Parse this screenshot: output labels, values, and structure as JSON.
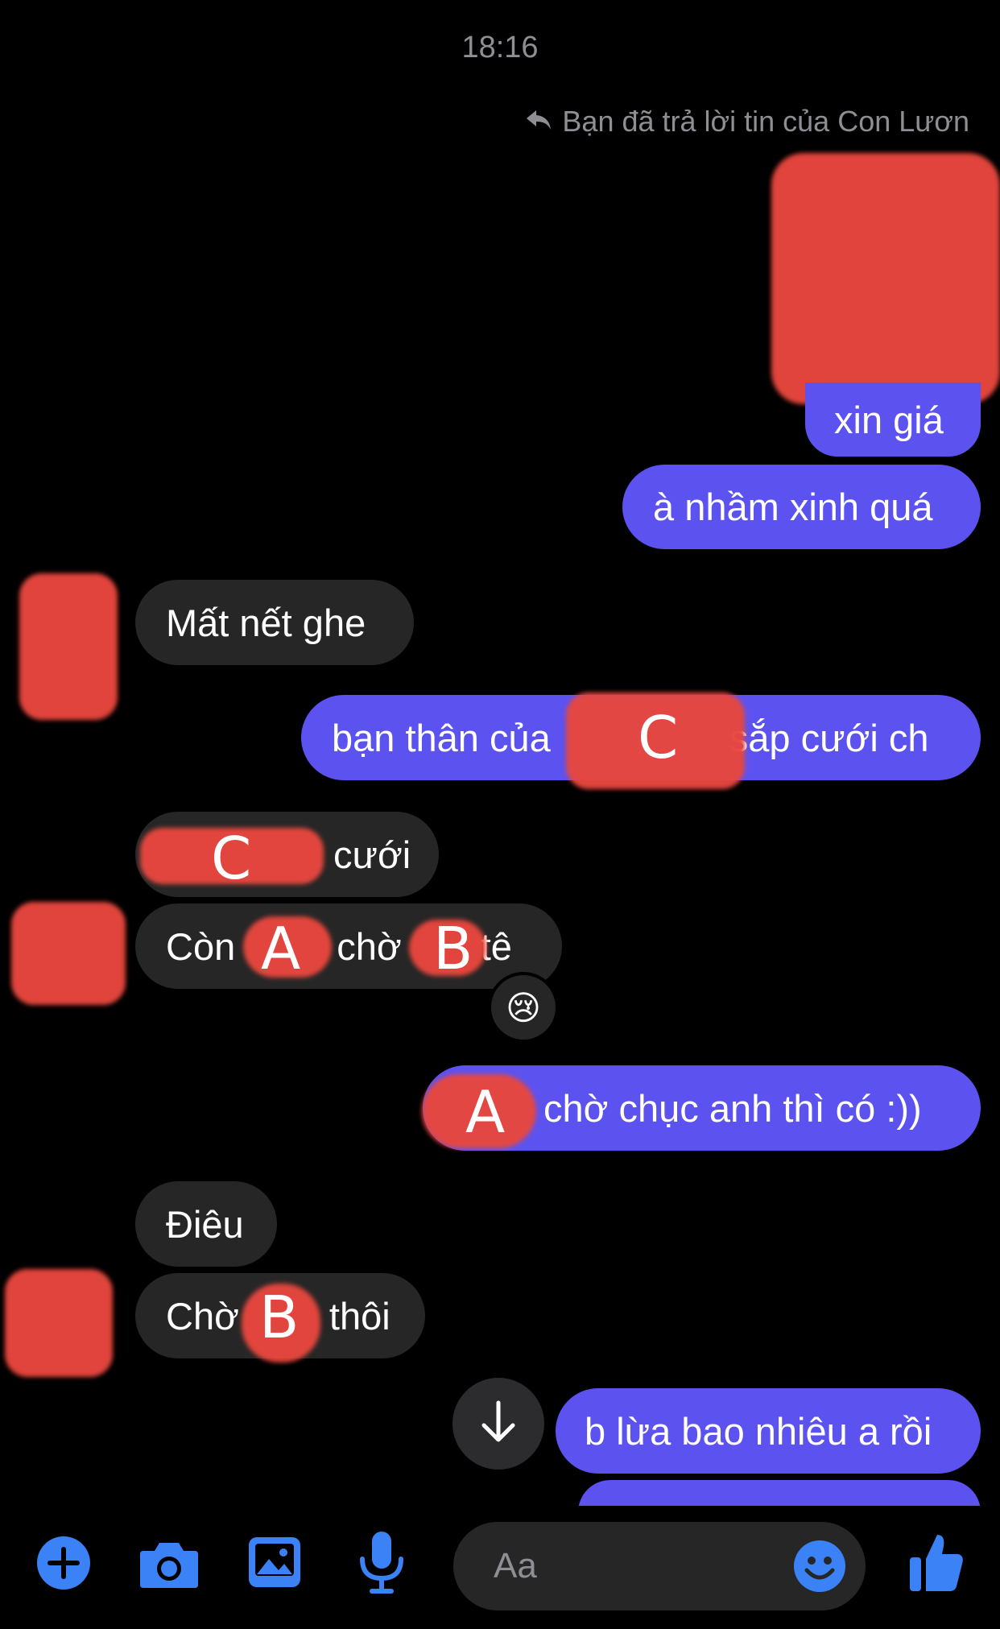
{
  "header": {
    "time": "18:16",
    "reply_note": "Bạn đã trả lời tin của Con Lươn"
  },
  "messages": [
    {
      "text": "xin giá"
    },
    {
      "text": "à nhầm xinh quá"
    },
    {
      "text": "Mất nết ghe"
    },
    {
      "before": "bạn thân của",
      "marker": "C",
      "after": "sắp cưới ch"
    },
    {
      "marker": "C",
      "after": "cưới"
    },
    {
      "before": "Còn",
      "marker1": "A",
      "middle": "chờ",
      "marker2": "B",
      "after": "tê",
      "reaction": "😢"
    },
    {
      "marker": "A",
      "after": "chờ chục anh thì có :))"
    },
    {
      "text": "Điêu"
    },
    {
      "before": "Chờ",
      "marker": "B",
      "after": "thôi"
    },
    {
      "text": "b lừa bao nhiêu a rồi"
    }
  ],
  "composer": {
    "placeholder": "Aa"
  },
  "icons": {
    "plus": "plus-circle-icon",
    "camera": "camera-icon",
    "gallery": "image-icon",
    "mic": "microphone-icon",
    "emoji": "smiley-icon",
    "like": "thumbs-up-icon",
    "reply": "reply-arrow-icon",
    "scroll": "arrow-down-icon"
  },
  "colors": {
    "sent_bubble": "#5b52f0",
    "received_bubble": "#262626",
    "accent": "#3b82f6",
    "redaction": "#e8473e"
  }
}
